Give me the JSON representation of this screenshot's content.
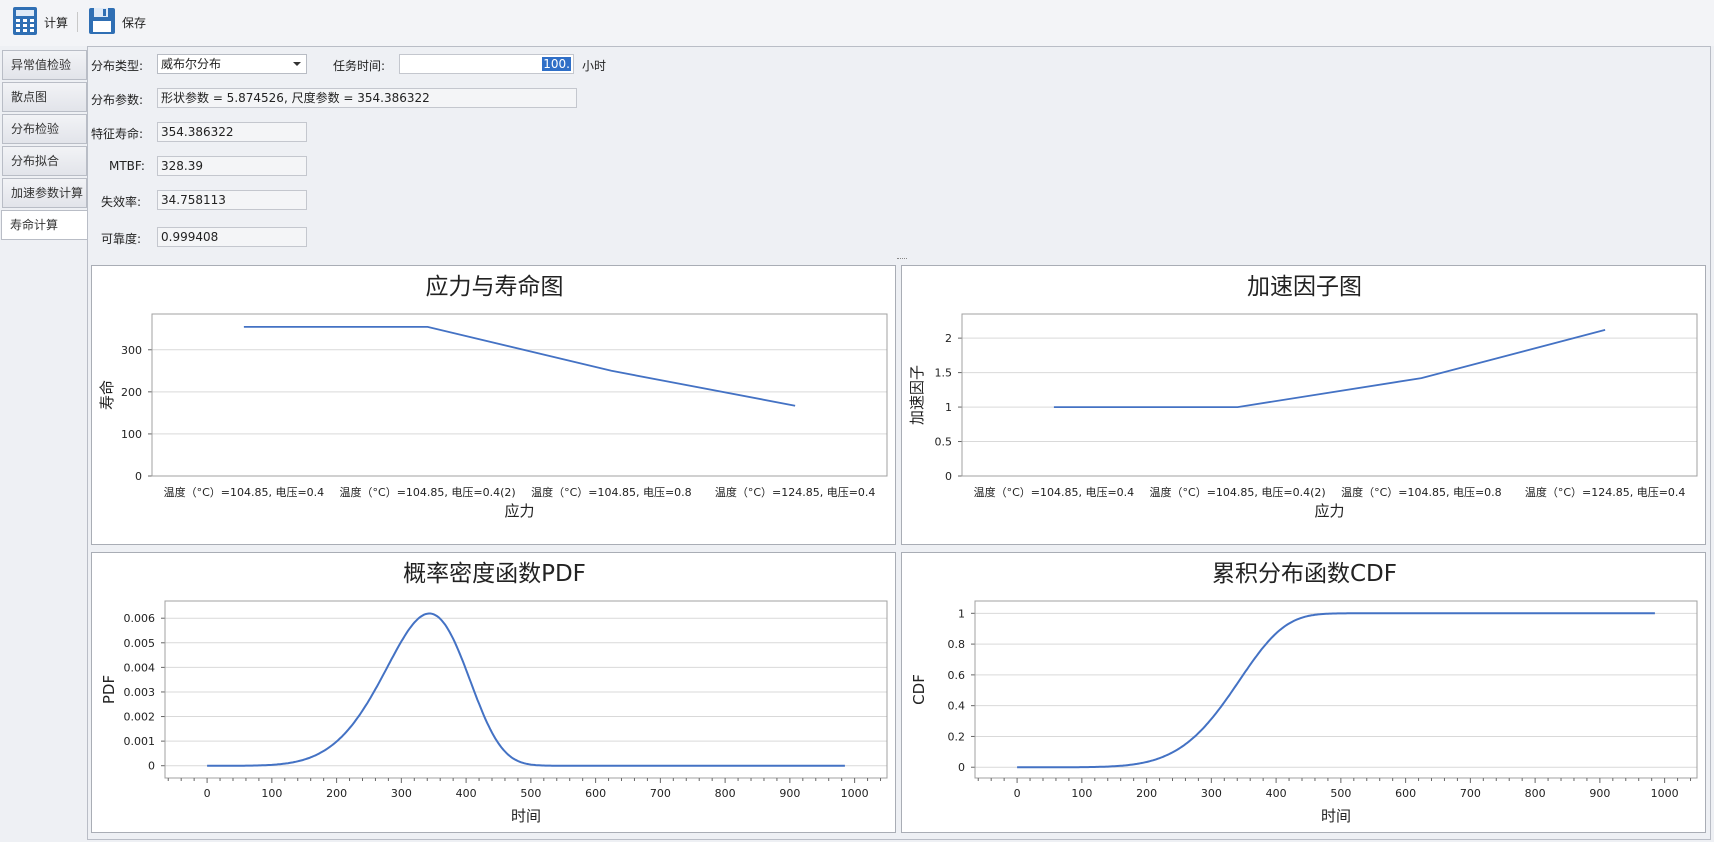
{
  "toolbar": {
    "calc_label": "计算",
    "save_label": "保存"
  },
  "sidebar": {
    "tabs": [
      "异常值检验",
      "散点图",
      "分布检验",
      "分布拟合",
      "加速参数计算",
      "寿命计算"
    ],
    "active_index": 5
  },
  "form": {
    "dist_type_label": "分布类型:",
    "dist_type_value": "威布尔分布",
    "task_time_label": "任务时间:",
    "task_time_value": "100.",
    "task_time_unit": "小时",
    "dist_params_label": "分布参数:",
    "dist_params_value": "形状参数 = 5.874526, 尺度参数 = 354.386322",
    "char_life_label": "特征寿命:",
    "char_life_value": "354.386322",
    "mtbf_label": "MTBF:",
    "mtbf_value": "328.39",
    "failure_rate_label": "失效率:",
    "failure_rate_value": "34.758113",
    "reliability_label": "可靠度:",
    "reliability_value": "0.999408"
  },
  "colors": {
    "line": "#4472c4",
    "grid": "#d9d9d9",
    "plot_border": "#a0a0a0"
  },
  "chart_data": [
    {
      "type": "line",
      "title": "应力与寿命图",
      "xlabel": "应力",
      "ylabel": "寿命",
      "categories": [
        "温度（°C）=104.85, 电压=0.4",
        "温度（°C）=104.85, 电压=0.4(2)",
        "温度（°C）=104.85, 电压=0.8",
        "温度（°C）=124.85, 电压=0.4"
      ],
      "values": [
        354.39,
        354.39,
        250,
        167
      ],
      "ylim": [
        0,
        385
      ],
      "yticks": [
        0,
        100,
        200,
        300
      ],
      "grid": true
    },
    {
      "type": "line",
      "title": "加速因子图",
      "xlabel": "应力",
      "ylabel": "加速因子",
      "categories": [
        "温度（°C）=104.85, 电压=0.4",
        "温度（°C）=104.85, 电压=0.4(2)",
        "温度（°C）=104.85, 电压=0.8",
        "温度（°C）=124.85, 电压=0.4"
      ],
      "values": [
        1,
        1,
        1.42,
        2.12
      ],
      "ylim": [
        0,
        2.35
      ],
      "yticks": [
        0,
        0.5,
        1,
        1.5,
        2
      ],
      "grid": true
    },
    {
      "type": "line",
      "title": "概率密度函数PDF",
      "xlabel": "时间",
      "ylabel": "PDF",
      "curve": "weibull_pdf",
      "shape": 5.874526,
      "scale": 354.386322,
      "x_range": [
        0,
        985
      ],
      "xlim": [
        -65,
        1050
      ],
      "xticks": [
        0,
        100,
        200,
        300,
        400,
        500,
        600,
        700,
        800,
        900,
        1000
      ],
      "ylim": [
        -0.0005,
        0.0067
      ],
      "yticks": [
        0,
        0.001,
        0.002,
        0.003,
        0.004,
        0.005,
        0.006
      ],
      "grid": true
    },
    {
      "type": "line",
      "title": "累积分布函数CDF",
      "xlabel": "时间",
      "ylabel": "CDF",
      "curve": "weibull_cdf",
      "shape": 5.874526,
      "scale": 354.386322,
      "x_range": [
        0,
        985
      ],
      "xlim": [
        -65,
        1050
      ],
      "xticks": [
        0,
        100,
        200,
        300,
        400,
        500,
        600,
        700,
        800,
        900,
        1000
      ],
      "ylim": [
        -0.07,
        1.08
      ],
      "yticks": [
        0,
        0.2,
        0.4,
        0.6,
        0.8,
        1
      ],
      "grid": true
    }
  ]
}
